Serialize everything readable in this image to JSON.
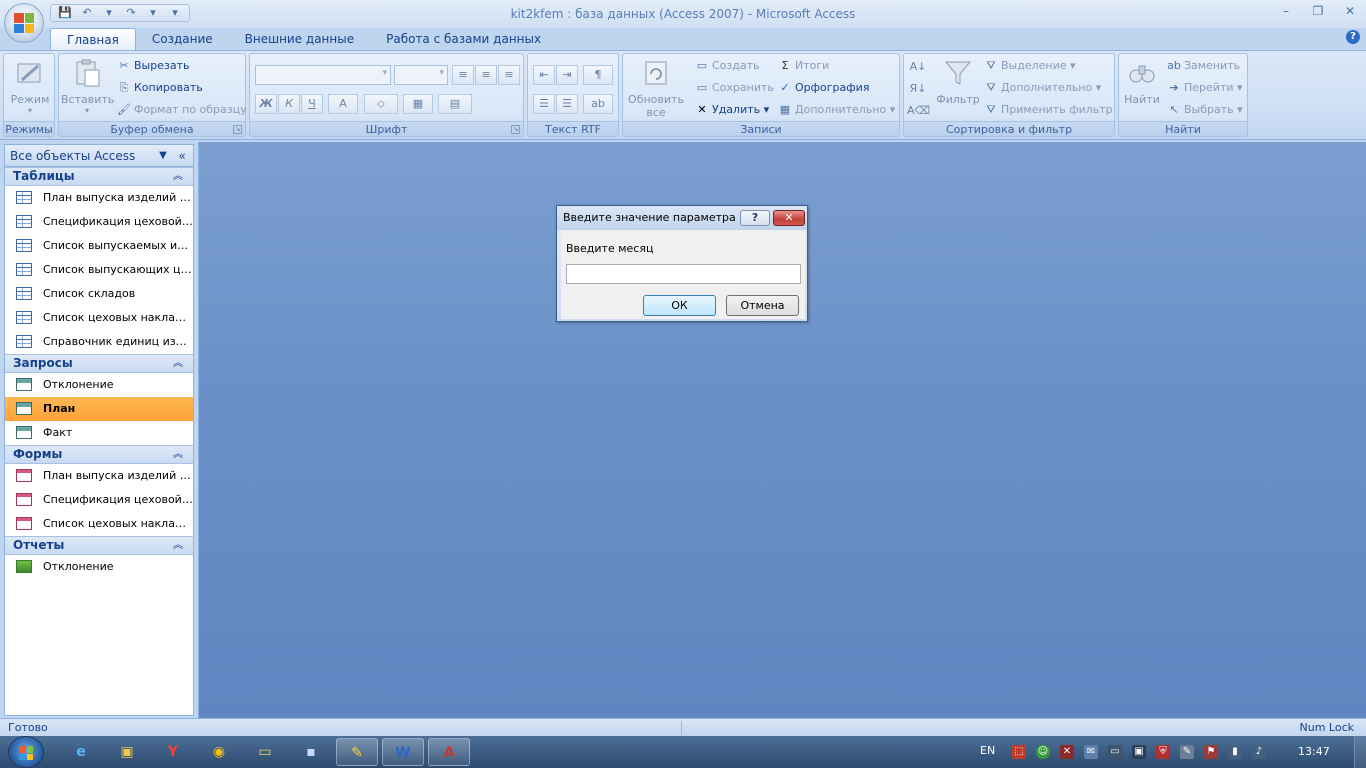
{
  "window": {
    "title": "kit2kfem : база данных (Access 2007) - Microsoft Access",
    "controls": [
      "–",
      "❐",
      "✕"
    ]
  },
  "qat": {
    "save": "💾",
    "undo": "↶",
    "undo_dd": "▾",
    "redo": "↷",
    "redo_dd": "▾",
    "customize": "▾"
  },
  "tabs": [
    "Главная",
    "Создание",
    "Внешние данные",
    "Работа с базами данных"
  ],
  "help": "?",
  "ribbon": {
    "groups": {
      "modes": {
        "label": "Режимы",
        "view": "Режим",
        "view_dd": "▾"
      },
      "clipboard": {
        "label": "Буфер обмена",
        "paste": "Вставить",
        "paste_dd": "▾",
        "cut": "Вырезать",
        "copy": "Копировать",
        "format_painter": "Формат по образцу"
      },
      "font": {
        "label": "Шрифт",
        "bold": "Ж",
        "italic": "К",
        "underline": "Ч",
        "font_color": "A",
        "fill": "⬦",
        "grid": "▦",
        "alt": "▤"
      },
      "rtf": {
        "label": "Текст RTF"
      },
      "records": {
        "label": "Записи",
        "refresh": "Обновить",
        "refresh2": "все",
        "new": "Создать",
        "save": "Сохранить",
        "delete": "Удалить",
        "totals": "Итоги",
        "spelling": "Орфография",
        "more": "Дополнительно"
      },
      "sort": {
        "label": "Сортировка и фильтр",
        "filter": "Фильтр",
        "selection": "Выделение",
        "advanced": "Дополнительно",
        "toggle": "Применить фильтр"
      },
      "find": {
        "label": "Найти",
        "find": "Найти",
        "replace": "Заменить",
        "goto": "Перейти",
        "select": "Выбрать"
      }
    }
  },
  "nav": {
    "title": "Все объекты Access",
    "groups": [
      {
        "label": "Таблицы",
        "type": "table",
        "items": [
          "План выпуска изделий це...",
          "Спецификация цеховой ...",
          "Список выпускаемых изд...",
          "Список выпускающих цех...",
          "Список складов",
          "Список цеховых накладн...",
          "Справочник единиц изм..."
        ]
      },
      {
        "label": "Запросы",
        "type": "query",
        "items": [
          "Отклонение",
          "План",
          "Факт"
        ]
      },
      {
        "label": "Формы",
        "type": "form",
        "items": [
          "План выпуска изделий це...",
          "Спецификация цеховой ...",
          "Список цеховых накладн..."
        ]
      },
      {
        "label": "Отчеты",
        "type": "report",
        "items": [
          "Отклонение"
        ]
      }
    ],
    "selected": "План"
  },
  "dialog": {
    "title": "Введите значение параметра",
    "help": "?",
    "close": "✕",
    "prompt": "Введите месяц",
    "value": "",
    "ok": "ОК",
    "cancel": "Отмена"
  },
  "status": {
    "left": "Готово",
    "right": "Num Lock"
  },
  "taskbar": {
    "tray_lang": "EN",
    "clock": "13:47"
  }
}
